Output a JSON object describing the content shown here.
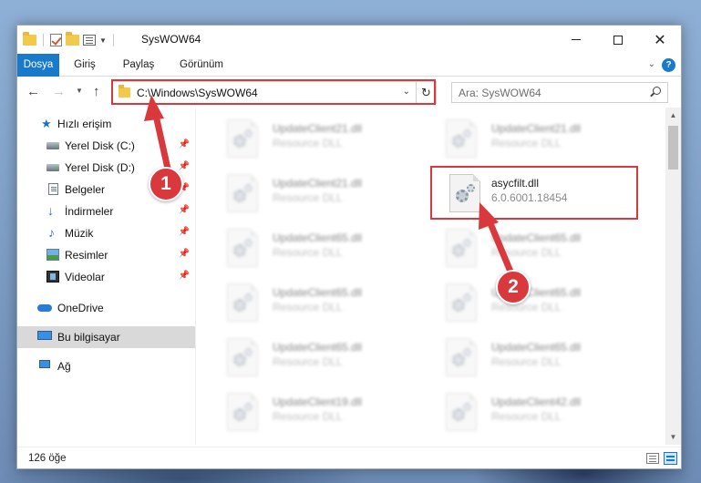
{
  "window": {
    "title": "SysWOW64"
  },
  "ribbon": {
    "tabs": [
      "Dosya",
      "Giriş",
      "Paylaş",
      "Görünüm"
    ],
    "file_tab_color": "#1979ca"
  },
  "navigation": {
    "address": "C:\\Windows\\SysWOW64",
    "search_placeholder": "Ara: SysWOW64"
  },
  "sidebar": {
    "quick_access": "Hızlı erişim",
    "items": [
      {
        "label": "Yerel Disk (C:)",
        "icon": "drive-icon",
        "pinned": true
      },
      {
        "label": "Yerel Disk (D:)",
        "icon": "drive-icon",
        "pinned": true
      },
      {
        "label": "Belgeler",
        "icon": "documents-icon",
        "pinned": true
      },
      {
        "label": "İndirmeler",
        "icon": "download-icon",
        "pinned": true
      },
      {
        "label": "Müzik",
        "icon": "music-icon",
        "pinned": true
      },
      {
        "label": "Resimler",
        "icon": "pictures-icon",
        "pinned": true
      },
      {
        "label": "Videolar",
        "icon": "videos-icon",
        "pinned": true
      }
    ],
    "onedrive": "OneDrive",
    "this_pc": "Bu bilgisayar",
    "network": "Ağ"
  },
  "files": {
    "left_column": [
      {
        "name": "UpdateClient21.dll",
        "type": "Resource DLL"
      },
      {
        "name": "UpdateClient21.dll",
        "type": "Resource DLL"
      },
      {
        "name": "UpdateClient65.dll",
        "type": "Resource DLL"
      },
      {
        "name": "UpdateClient65.dll",
        "type": "Resource DLL"
      },
      {
        "name": "UpdateClient65.dll",
        "type": "Resource DLL"
      },
      {
        "name": "UpdateClient19.dll",
        "type": "Resource DLL"
      }
    ],
    "right_column": [
      {
        "name": "UpdateClient21.dll",
        "type": "Resource DLL"
      },
      {
        "name": "asycfilt.dll",
        "type": "6.0.6001.18454",
        "highlighted": true
      },
      {
        "name": "UpdateClient65.dll",
        "type": "Resource DLL"
      },
      {
        "name": "UpdateClient65.dll",
        "type": "Resource DLL"
      },
      {
        "name": "UpdateClient65.dll",
        "type": "Resource DLL"
      },
      {
        "name": "UpdateClient42.dll",
        "type": "Resource DLL"
      }
    ]
  },
  "status": {
    "count": "126 öğe"
  },
  "annotations": {
    "step1": "1",
    "step2": "2",
    "color": "#d9393c"
  }
}
